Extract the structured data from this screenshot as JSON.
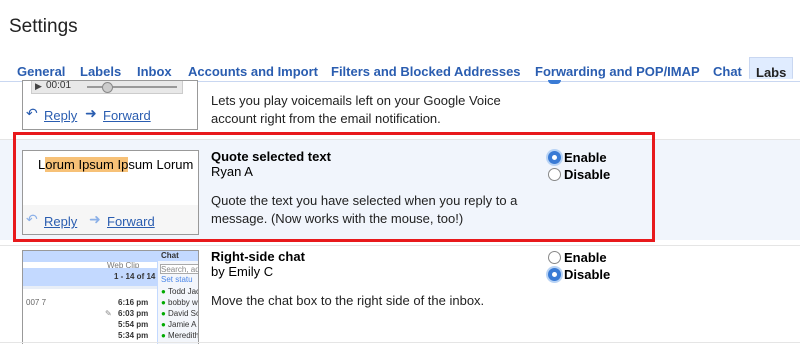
{
  "app": {
    "title": "Settings"
  },
  "tabs": [
    {
      "label": "General"
    },
    {
      "label": "Labels"
    },
    {
      "label": "Inbox"
    },
    {
      "label": "Accounts and Import"
    },
    {
      "label": "Filters and Blocked Addresses"
    },
    {
      "label": "Forwarding and POP/IMAP"
    },
    {
      "label": "Chat"
    },
    {
      "label": "Labs"
    }
  ],
  "active_tab": "Labs",
  "features": [
    {
      "name": "",
      "author": "",
      "description": "Lets you play voicemails left on your Google Voice account right from the email notification.",
      "thumb": {
        "time": "00:01",
        "reply": "Reply",
        "forward": "Forward"
      }
    },
    {
      "name": "Quote selected text",
      "author": "Ryan A",
      "description": "Quote the text you have selected when you reply to a message. (Now works with the mouse, too!)",
      "thumb": {
        "text_pre": "L",
        "text_highlight": "orum Ipsum Ip",
        "text_post": "sum Lorum I",
        "reply": "Reply",
        "forward": "Forward"
      },
      "options": [
        {
          "label": "Enable",
          "selected": true
        },
        {
          "label": "Disable",
          "selected": false
        }
      ]
    },
    {
      "name": "Right-side chat",
      "author": "by Emily C",
      "description": "Move the chat box to the right side of the inbox.",
      "thumb": {
        "web_clip": "Web Clip",
        "count": "1 - 14 of 14",
        "times": [
          "6:16 pm",
          "6:03 pm",
          "5:54 pm",
          "5:34 pm"
        ],
        "row_prefix": "007 7",
        "chat_title": "Chat",
        "search_placeholder": "Search, add",
        "set_status": "Set statu",
        "contacts": [
          "Todd Jac",
          "bobby wi",
          "David So",
          "Jamie A",
          "Meredith"
        ]
      },
      "options": [
        {
          "label": "Enable",
          "selected": false
        },
        {
          "label": "Disable",
          "selected": true
        }
      ]
    }
  ],
  "colors": {
    "link": "#2a5db0",
    "highlight_row": "#f1f5fc",
    "focus_border": "#e8191c",
    "tab_active_bg": "#e0ecff"
  }
}
